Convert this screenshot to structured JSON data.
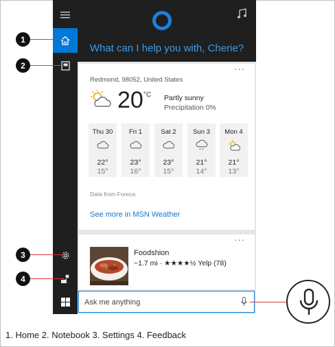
{
  "greeting": "What can I help you with, Cherie?",
  "rail": {
    "items": [
      {
        "name": "hamburger-menu-icon"
      },
      {
        "name": "home-icon"
      },
      {
        "name": "notebook-icon"
      },
      {
        "name": "settings-icon"
      },
      {
        "name": "feedback-icon"
      }
    ]
  },
  "weather": {
    "more": "···",
    "location": "Redmond, 98052, United States",
    "temp": "20",
    "unit": "°C",
    "condition": "Partly sunny",
    "precipitation": "Precipitation 0%",
    "forecast": [
      {
        "day": "Thu 30",
        "icon": "cloud-icon",
        "hi": "22°",
        "lo": "15°"
      },
      {
        "day": "Fri 1",
        "icon": "cloud-icon",
        "hi": "23°",
        "lo": "16°"
      },
      {
        "day": "Sat 2",
        "icon": "cloud-icon",
        "hi": "23°",
        "lo": "15°"
      },
      {
        "day": "Sun 3",
        "icon": "rain-cloud-icon",
        "hi": "21°",
        "lo": "14°"
      },
      {
        "day": "Mon 4",
        "icon": "partly-sunny-icon",
        "hi": "21°",
        "lo": "13°"
      }
    ],
    "source": "Data from Foreca",
    "more_link": "See more in MSN Weather"
  },
  "restaurant": {
    "more": "···",
    "name": "Foodshion",
    "info": "~1.7 mi · ★★★★½ Yelp (78)"
  },
  "search": {
    "placeholder": "Ask me anything"
  },
  "callouts": [
    "1",
    "2",
    "3",
    "4"
  ],
  "caption": "1. Home 2. Notebook 3. Settings 4. Feedback",
  "colors": {
    "accent": "#0078d7",
    "dark": "#1f1f1f",
    "link": "#1b73c8",
    "callout_line": "#dd3333"
  }
}
